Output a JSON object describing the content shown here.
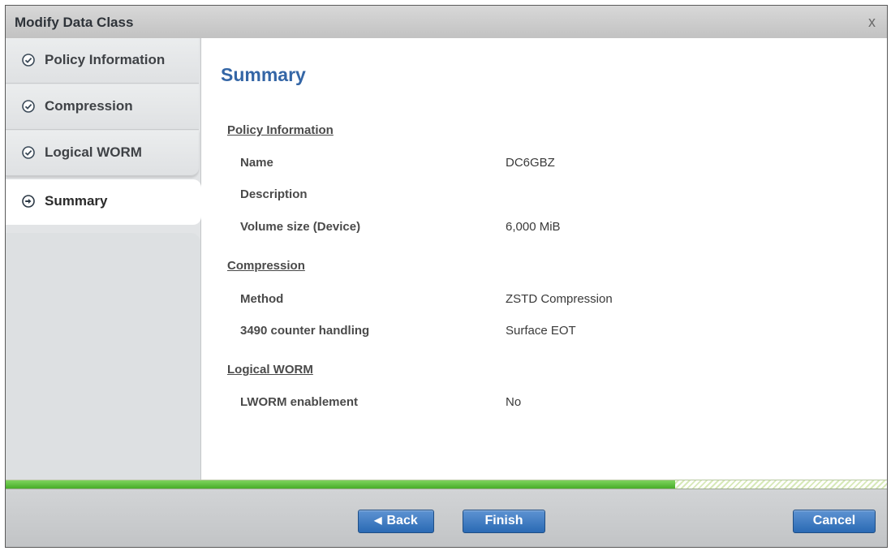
{
  "window": {
    "title": "Modify Data Class",
    "close_glyph": "x"
  },
  "sidebar": {
    "items": [
      {
        "label": "Policy Information",
        "state": "complete",
        "icon": "check-circle-icon"
      },
      {
        "label": "Compression",
        "state": "complete",
        "icon": "check-circle-icon"
      },
      {
        "label": "Logical WORM",
        "state": "complete",
        "icon": "check-circle-icon"
      },
      {
        "label": "Summary",
        "state": "current",
        "icon": "arrow-circle-icon"
      }
    ]
  },
  "summary": {
    "heading": "Summary",
    "sections": [
      {
        "title": "Policy Information",
        "rows": [
          {
            "label": "Name",
            "value": "DC6GBZ"
          },
          {
            "label": "Description",
            "value": ""
          },
          {
            "label": "Volume size (Device)",
            "value": "6,000 MiB"
          }
        ]
      },
      {
        "title": "Compression",
        "rows": [
          {
            "label": "Method",
            "value": "ZSTD Compression"
          },
          {
            "label": "3490 counter handling",
            "value": "Surface EOT"
          }
        ]
      },
      {
        "title": "Logical WORM",
        "rows": [
          {
            "label": "LWORM enablement",
            "value": "No"
          }
        ]
      }
    ]
  },
  "progress": {
    "fraction": 0.76,
    "fill_color": "#4fb52f"
  },
  "footer": {
    "back_label": "Back",
    "back_icon": "left-triangle-icon",
    "finish_label": "Finish",
    "cancel_label": "Cancel"
  },
  "colors": {
    "accent": "#3466a6",
    "button": "#3a78c0"
  }
}
